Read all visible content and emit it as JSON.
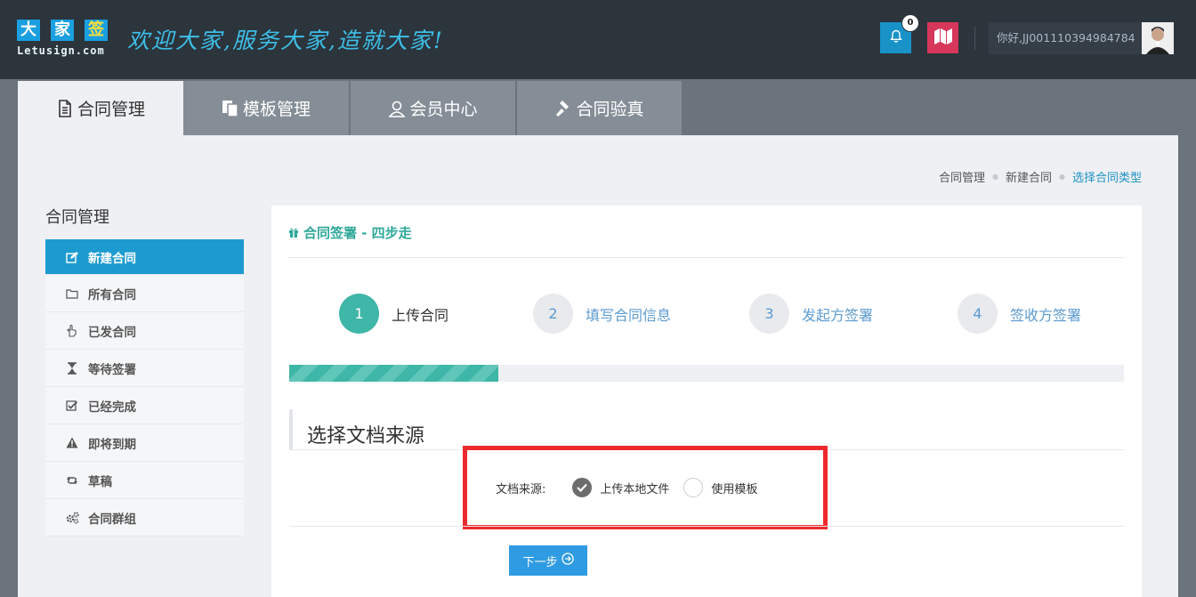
{
  "header": {
    "logo_chars": [
      "大",
      "家",
      "签"
    ],
    "logo_text": "Letusign.com",
    "slogan": "欢迎大家,服务大家,造就大家!",
    "notification_count": "0",
    "user_greeting": "你好,JJ001110394984784",
    "icons": {
      "bell": "bell-icon",
      "map": "map-icon",
      "avatar": "avatar"
    },
    "colors": {
      "bell_bg": "#1992c8",
      "map_bg": "#d6375a",
      "header_bg": "#2c343c"
    }
  },
  "tabs": [
    {
      "label": "合同管理",
      "icon": "document-icon",
      "active": true
    },
    {
      "label": "模板管理",
      "icon": "copy-icon",
      "active": false
    },
    {
      "label": "会员中心",
      "icon": "user-icon",
      "active": false
    },
    {
      "label": "合同验真",
      "icon": "gavel-icon",
      "active": false
    }
  ],
  "breadcrumb": [
    "合同管理",
    "新建合同",
    "选择合同类型"
  ],
  "sidebar": {
    "title": "合同管理",
    "items": [
      {
        "label": "新建合同",
        "icon": "edit-icon",
        "active": true
      },
      {
        "label": "所有合同",
        "icon": "folder-icon"
      },
      {
        "label": "已发合同",
        "icon": "hand-icon"
      },
      {
        "label": "等待签署",
        "icon": "hourglass-icon"
      },
      {
        "label": "已经完成",
        "icon": "check-square-icon"
      },
      {
        "label": "即将到期",
        "icon": "warning-icon"
      },
      {
        "label": "草稿",
        "icon": "retweet-icon"
      },
      {
        "label": "合同群组",
        "icon": "gears-icon"
      }
    ]
  },
  "panel": {
    "title": "合同签署 - 四步走",
    "steps": [
      {
        "num": "1",
        "label": "上传合同",
        "active": true
      },
      {
        "num": "2",
        "label": "填写合同信息",
        "active": false
      },
      {
        "num": "3",
        "label": "发起方签署",
        "active": false
      },
      {
        "num": "4",
        "label": "签收方签署",
        "active": false
      }
    ],
    "progress": 0.25,
    "section_title": "选择文档来源",
    "source_label": "文档来源:",
    "options": [
      {
        "label": "上传本地文件",
        "checked": true
      },
      {
        "label": "使用模板",
        "checked": false
      }
    ],
    "next_label": "下一步",
    "accent_color": "#3eb6a8",
    "highlight_color": "#ee2a2e"
  }
}
